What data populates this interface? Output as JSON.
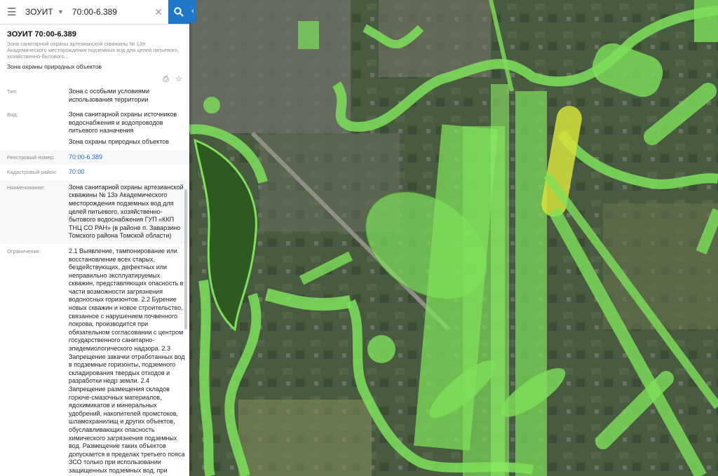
{
  "search": {
    "layer": "ЗОУИТ",
    "query": "70:00-6.389"
  },
  "card": {
    "title": "ЗОУИТ 70:00-6.389",
    "subtitle": "Зона санитарной охраны артезианской скважины № 13э Академического месторождения подземных вод для целей питьевого, хозяйственно-бытового...",
    "category": "Зона охраны природных объектов"
  },
  "fields": [
    {
      "label": "Тип:",
      "value": "Зона с особыми условиями использования территории"
    },
    {
      "label": "Вид:",
      "value": "Зона санитарной охраны источников водоснабжения и водопроводов питьевого назначения",
      "value2": "Зона охраны природных объектов"
    },
    {
      "label": "Реестровый номер:",
      "value": "70:00-6.389"
    },
    {
      "label": "Кадастровый район:",
      "value": "70:00"
    },
    {
      "label": "Наименование:",
      "value": "Зона санитарной охраны артезианской скважины № 13э Академического месторождения подземных вод для целей питьевого, хозяйственно-бытового водоснабжения ГУП «ККП ТНЦ СО РАН» (в районе п. Заварзино Томского района Томской области)"
    },
    {
      "label": "Ограничение:",
      "value": "2.1 Выявление, тампонирование или восстановление всех старых, бездействующих, дефектных или неправильно эксплуатируемых скважин, представляющих опасность в части возможности загрязнения водоносных горизонтов. 2.2 Бурение новых скважин и новое строительство, связанное с нарушением почвенного покрова, производится при обязательном согласовании с центром государственного санитарно-эпидемиологического надзора. 2.3 Запрещение закачки отработанных вод в подземные горизонты, подземного складирования твердых отходов и разработки недр земли. 2.4 Запрещение размещения складов горюче-смазочных материалов, ядохимикатов и минеральных удобрений, накопителей промстоков, шламохранилищ и других объектов, обуславливающих опасность химического загрязнения подземных вод. Размещение таких объектов допускается в пределах третьего пояса ЗСО только при использовании защищенных подземных вод, при условии выполнения специальных мероприятий по защите водоносного"
    }
  ],
  "colors": {
    "accent": "#1f78c8",
    "zone_fill": "#7ee05a",
    "selected_zone": "#d6e23a",
    "river": "#2e5a22"
  },
  "icons": [
    "menu-icon",
    "chevron-down-icon",
    "clear-icon",
    "search-icon",
    "collapse-icon",
    "print-icon",
    "star-icon"
  ]
}
